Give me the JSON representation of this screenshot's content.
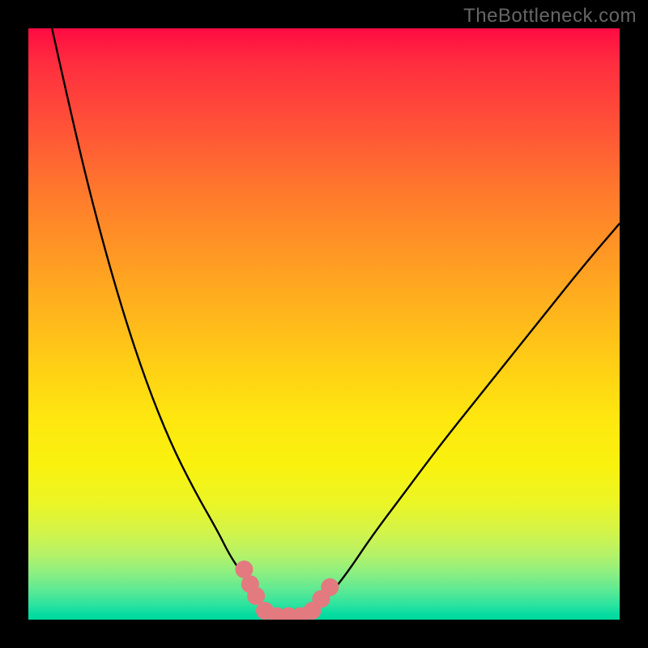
{
  "watermark": "TheBottleneck.com",
  "chart_data": {
    "type": "line",
    "title": "",
    "xlabel": "",
    "ylabel": "",
    "xlim": [
      0,
      100
    ],
    "ylim": [
      0,
      100
    ],
    "gradient_background": [
      {
        "pct": 0,
        "color": "#ff0b42"
      },
      {
        "pct": 28,
        "color": "#ff7a2c"
      },
      {
        "pct": 56,
        "color": "#ffcc16"
      },
      {
        "pct": 80,
        "color": "#ecf524"
      },
      {
        "pct": 95,
        "color": "#5de994"
      },
      {
        "pct": 100,
        "color": "#00d89c"
      }
    ],
    "series": [
      {
        "name": "left-branch",
        "x": [
          4,
          8,
          12,
          16,
          20,
          24,
          28,
          32,
          34,
          36,
          38,
          39,
          40
        ],
        "y": [
          100,
          82,
          66,
          52,
          40,
          30,
          22,
          15,
          11,
          8,
          5,
          3,
          1
        ]
      },
      {
        "name": "valley",
        "x": [
          40,
          41,
          42,
          44,
          46,
          48
        ],
        "y": [
          1,
          0.4,
          0.2,
          0.2,
          0.4,
          1
        ]
      },
      {
        "name": "right-branch",
        "x": [
          48,
          50,
          54,
          58,
          64,
          70,
          78,
          86,
          94,
          100
        ],
        "y": [
          1,
          3,
          8,
          14,
          22,
          30,
          40,
          50,
          60,
          67
        ]
      }
    ],
    "markers": {
      "color": "#e27a80",
      "points": [
        {
          "x": 36.5,
          "y": 8.5
        },
        {
          "x": 37.5,
          "y": 6
        },
        {
          "x": 38.5,
          "y": 4
        },
        {
          "x": 40.0,
          "y": 1.5
        },
        {
          "x": 42.0,
          "y": 0.6
        },
        {
          "x": 44.0,
          "y": 0.6
        },
        {
          "x": 46.0,
          "y": 0.6
        },
        {
          "x": 48.0,
          "y": 1.5
        },
        {
          "x": 49.5,
          "y": 3.5
        },
        {
          "x": 51.0,
          "y": 5.5
        }
      ]
    }
  }
}
